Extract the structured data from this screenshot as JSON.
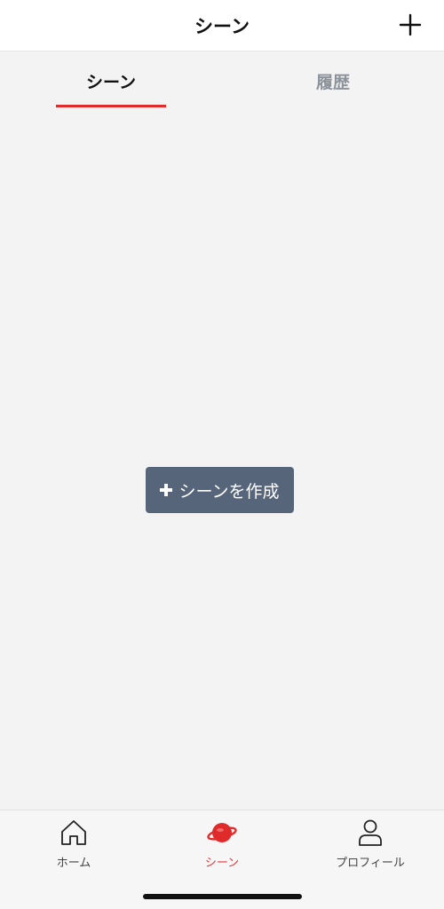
{
  "header": {
    "title": "シーン",
    "add_icon": "plus-icon"
  },
  "tabs": [
    {
      "label": "シーン",
      "active": true
    },
    {
      "label": "履歴",
      "active": false
    }
  ],
  "main": {
    "create_button_label": "シーンを作成",
    "create_button_icon": "plus-icon"
  },
  "tabbar": {
    "items": [
      {
        "label": "ホーム",
        "icon": "home-icon",
        "active": false
      },
      {
        "label": "シーン",
        "icon": "planet-icon",
        "active": true
      },
      {
        "label": "プロフィール",
        "icon": "person-icon",
        "active": false
      }
    ]
  },
  "colors": {
    "accent": "#e02b2b",
    "button_bg": "#57657b",
    "background": "#f3f3f4"
  }
}
